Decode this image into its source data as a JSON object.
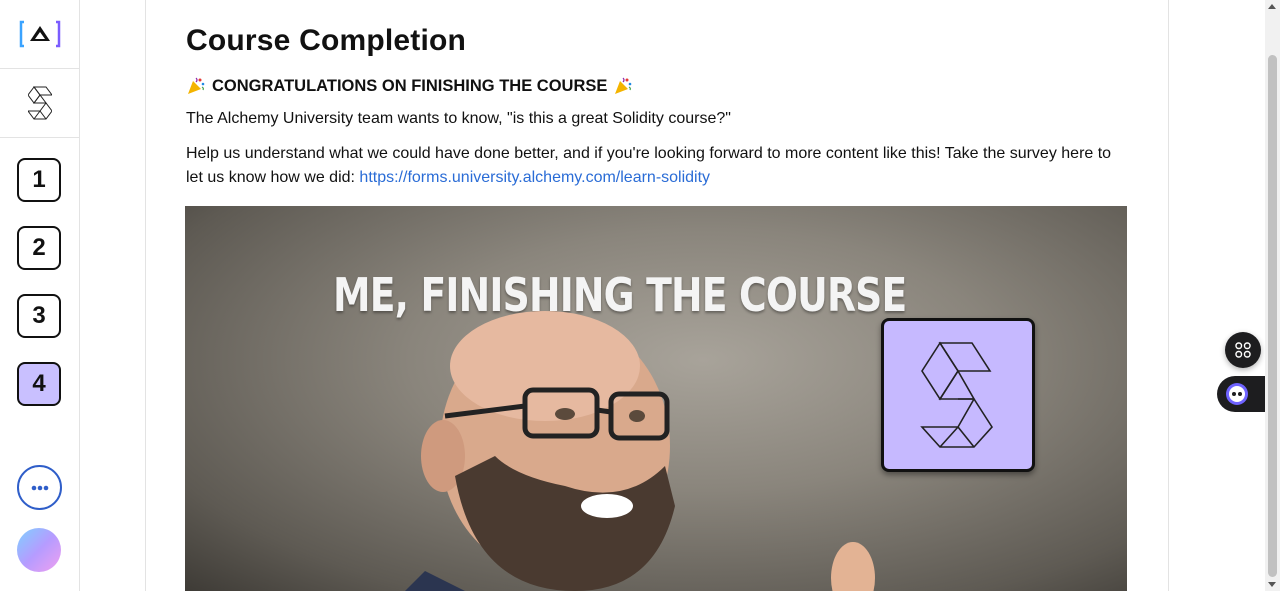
{
  "sidebar": {
    "logo_icon": "alchemy-logo",
    "course_icon": "solidity-logo-icon",
    "steps": [
      {
        "label": "1",
        "active": false
      },
      {
        "label": "2",
        "active": false
      },
      {
        "label": "3",
        "active": false
      },
      {
        "label": "4",
        "active": true
      }
    ],
    "more_icon": "more-dots-icon",
    "avatar_icon": "user-avatar"
  },
  "main": {
    "title": "Course Completion",
    "congrats": "CONGRATULATIONS ON FINISHING THE COURSE",
    "congrats_icon": "party-popper-icon",
    "paragraph1": "The Alchemy University team wants to know, \"is this a great Solidity course?\"",
    "paragraph2": "Help us understand what we could have done better, and if you're looking forward to more content like this! Take the survey here to let us know how we did: ",
    "survey_link": "https://forms.university.alchemy.com/learn-solidity",
    "video_caption": "ME, FINISHING THE COURSE"
  },
  "floating": {
    "apps_icon": "apps-grid-icon",
    "bot_icon": "assistant-bot-icon"
  },
  "colors": {
    "accent_purple": "#c9c0ff",
    "link_blue": "#2a6cd6",
    "more_button_blue": "#2f5ec9"
  }
}
